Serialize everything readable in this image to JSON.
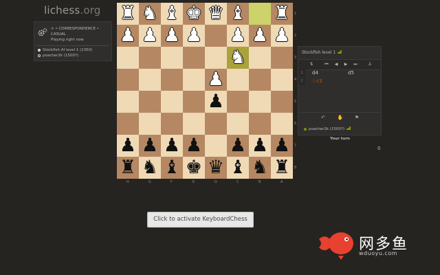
{
  "header": {
    "site": "lichess",
    "tld": ".org"
  },
  "game_info": {
    "line1": "∞ • CORRESPONDENCE •",
    "line2": "CASUAL",
    "line3": "Playing right now",
    "white_player": "Stockfish AI level 1 (1350)",
    "black_player": "poacher2k (1500?)"
  },
  "board": {
    "rank_labels": [
      "1",
      "2",
      "3",
      "4",
      "5",
      "6",
      "7",
      "8"
    ],
    "file_labels": [
      "H",
      "G",
      "F",
      "E",
      "D",
      "C",
      "B",
      "A"
    ],
    "rows": [
      [
        "♖",
        "♘",
        "♗",
        "♔",
        "♕",
        "♗",
        "",
        "♖"
      ],
      [
        "♙",
        "♙",
        "♙",
        "♙",
        "",
        "♙",
        "♙",
        "♙"
      ],
      [
        "",
        "",
        "",
        "",
        "",
        "♘",
        "",
        ""
      ],
      [
        "",
        "",
        "",
        "",
        "♙",
        "",
        "",
        ""
      ],
      [
        "",
        "",
        "",
        "",
        "♟",
        "",
        "",
        ""
      ],
      [
        "",
        "",
        "",
        "",
        "",
        "",
        "",
        ""
      ],
      [
        "♟",
        "♟",
        "♟",
        "♟",
        "",
        "♟",
        "♟",
        "♟"
      ],
      [
        "♜",
        "♞",
        "♝",
        "♚",
        "♛",
        "♝",
        "♞",
        "♜"
      ]
    ],
    "highlight": [
      [
        0,
        6
      ],
      [
        2,
        5
      ]
    ],
    "colors": {
      "light": "#f0d9b5",
      "dark": "#b58863"
    }
  },
  "panel": {
    "opponent": "Stockfish level 1",
    "moves": [
      {
        "num": "1",
        "white": "d4",
        "black": "d5"
      },
      {
        "num": "2",
        "white": "♘c3",
        "black": ""
      }
    ],
    "me": "poacher2k (1500?)"
  },
  "status": {
    "your_turn": "Your turn",
    "clock": "0"
  },
  "keyboard_button": "Click to activate KeyboardChess",
  "watermark": {
    "cn": "网多鱼",
    "url": "wduoyu.com"
  }
}
